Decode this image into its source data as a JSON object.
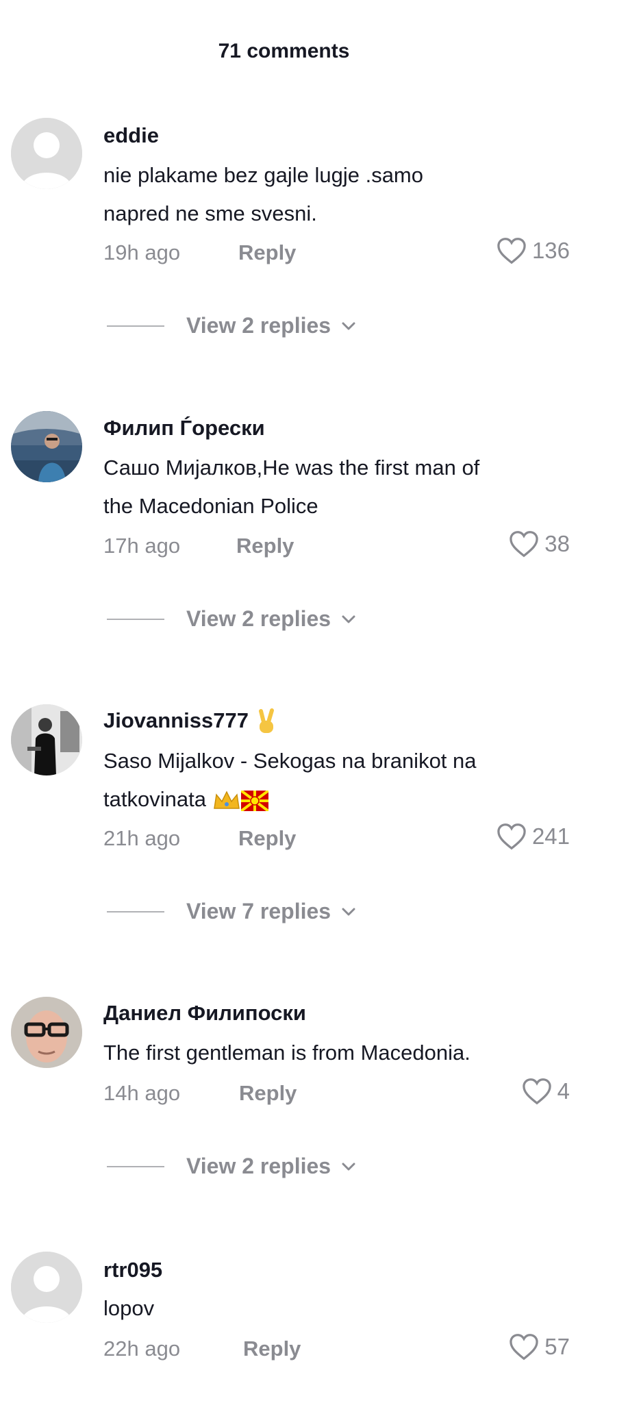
{
  "header": {
    "title": "71 comments"
  },
  "comments": [
    {
      "username": "eddie",
      "text": "nie plakame bez gajle lugje .samo napred ne sme svesni.",
      "text_line1": "nie plakame bez gajle lugje .samo",
      "text_line2": "napred ne sme svesni.",
      "time": "19h ago",
      "reply_label": "Reply",
      "likes": "136",
      "view_replies": "View 2 replies",
      "avatar": "default-avatar"
    },
    {
      "username": "Филип Ѓорески",
      "text": "Сашо Мијалков,He was the first man of the Macedonian Police",
      "text_line1": "Сашо Мијалков,He was the first man of",
      "text_line2": "the Macedonian Police",
      "time": "17h ago",
      "reply_label": "Reply",
      "likes": "38",
      "view_replies": "View 2 replies",
      "avatar": "photo-avatar"
    },
    {
      "username": "Jiovanniss777",
      "text_line1": "Saso Mijalkov - Sekogas na branikot na",
      "text_line2": "tatkovinata",
      "time": "21h ago",
      "reply_label": "Reply",
      "likes": "241",
      "view_replies": "View 7 replies",
      "avatar": "photo-avatar",
      "emojis": [
        "victory-hand",
        "crown",
        "macedonia-flag"
      ]
    },
    {
      "username": "Даниел Филипоски",
      "text_line1": "The first gentleman is from Macedonia.",
      "time": "14h ago",
      "reply_label": "Reply",
      "likes": "4",
      "view_replies": "View 2 replies",
      "avatar": "photo-avatar"
    },
    {
      "username": "rtr095",
      "text_line1": "lopov",
      "time": "22h ago",
      "reply_label": "Reply",
      "likes": "57",
      "avatar": "default-avatar"
    }
  ],
  "colors": {
    "text": "#161823",
    "secondary": "#8a8b91",
    "divider": "#b0b1b5"
  }
}
